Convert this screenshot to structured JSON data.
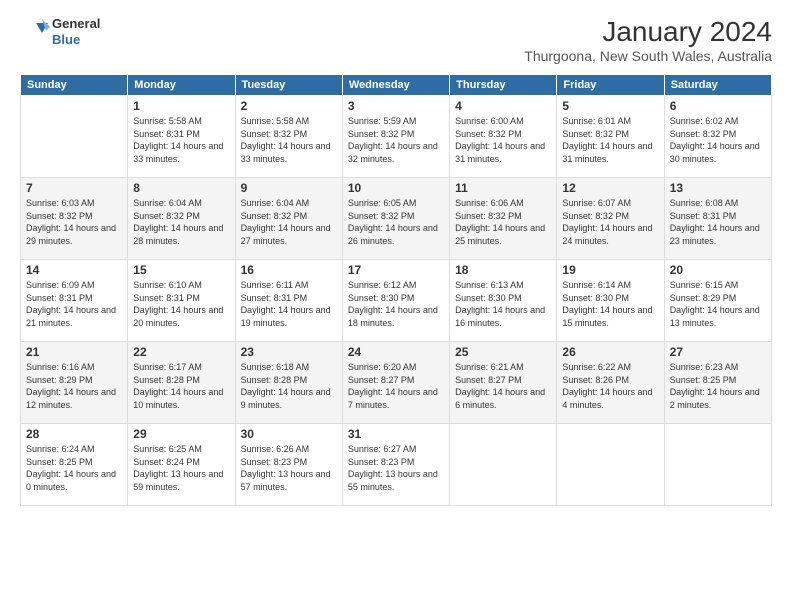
{
  "logo": {
    "line1": "General",
    "line2": "Blue"
  },
  "title": "January 2024",
  "subtitle": "Thurgoona, New South Wales, Australia",
  "weekdays": [
    "Sunday",
    "Monday",
    "Tuesday",
    "Wednesday",
    "Thursday",
    "Friday",
    "Saturday"
  ],
  "weeks": [
    [
      {
        "day": "",
        "sunrise": "",
        "sunset": "",
        "daylight": ""
      },
      {
        "day": "1",
        "sunrise": "Sunrise: 5:58 AM",
        "sunset": "Sunset: 8:31 PM",
        "daylight": "Daylight: 14 hours and 33 minutes."
      },
      {
        "day": "2",
        "sunrise": "Sunrise: 5:58 AM",
        "sunset": "Sunset: 8:32 PM",
        "daylight": "Daylight: 14 hours and 33 minutes."
      },
      {
        "day": "3",
        "sunrise": "Sunrise: 5:59 AM",
        "sunset": "Sunset: 8:32 PM",
        "daylight": "Daylight: 14 hours and 32 minutes."
      },
      {
        "day": "4",
        "sunrise": "Sunrise: 6:00 AM",
        "sunset": "Sunset: 8:32 PM",
        "daylight": "Daylight: 14 hours and 31 minutes."
      },
      {
        "day": "5",
        "sunrise": "Sunrise: 6:01 AM",
        "sunset": "Sunset: 8:32 PM",
        "daylight": "Daylight: 14 hours and 31 minutes."
      },
      {
        "day": "6",
        "sunrise": "Sunrise: 6:02 AM",
        "sunset": "Sunset: 8:32 PM",
        "daylight": "Daylight: 14 hours and 30 minutes."
      }
    ],
    [
      {
        "day": "7",
        "sunrise": "Sunrise: 6:03 AM",
        "sunset": "Sunset: 8:32 PM",
        "daylight": "Daylight: 14 hours and 29 minutes."
      },
      {
        "day": "8",
        "sunrise": "Sunrise: 6:04 AM",
        "sunset": "Sunset: 8:32 PM",
        "daylight": "Daylight: 14 hours and 28 minutes."
      },
      {
        "day": "9",
        "sunrise": "Sunrise: 6:04 AM",
        "sunset": "Sunset: 8:32 PM",
        "daylight": "Daylight: 14 hours and 27 minutes."
      },
      {
        "day": "10",
        "sunrise": "Sunrise: 6:05 AM",
        "sunset": "Sunset: 8:32 PM",
        "daylight": "Daylight: 14 hours and 26 minutes."
      },
      {
        "day": "11",
        "sunrise": "Sunrise: 6:06 AM",
        "sunset": "Sunset: 8:32 PM",
        "daylight": "Daylight: 14 hours and 25 minutes."
      },
      {
        "day": "12",
        "sunrise": "Sunrise: 6:07 AM",
        "sunset": "Sunset: 8:32 PM",
        "daylight": "Daylight: 14 hours and 24 minutes."
      },
      {
        "day": "13",
        "sunrise": "Sunrise: 6:08 AM",
        "sunset": "Sunset: 8:31 PM",
        "daylight": "Daylight: 14 hours and 23 minutes."
      }
    ],
    [
      {
        "day": "14",
        "sunrise": "Sunrise: 6:09 AM",
        "sunset": "Sunset: 8:31 PM",
        "daylight": "Daylight: 14 hours and 21 minutes."
      },
      {
        "day": "15",
        "sunrise": "Sunrise: 6:10 AM",
        "sunset": "Sunset: 8:31 PM",
        "daylight": "Daylight: 14 hours and 20 minutes."
      },
      {
        "day": "16",
        "sunrise": "Sunrise: 6:11 AM",
        "sunset": "Sunset: 8:31 PM",
        "daylight": "Daylight: 14 hours and 19 minutes."
      },
      {
        "day": "17",
        "sunrise": "Sunrise: 6:12 AM",
        "sunset": "Sunset: 8:30 PM",
        "daylight": "Daylight: 14 hours and 18 minutes."
      },
      {
        "day": "18",
        "sunrise": "Sunrise: 6:13 AM",
        "sunset": "Sunset: 8:30 PM",
        "daylight": "Daylight: 14 hours and 16 minutes."
      },
      {
        "day": "19",
        "sunrise": "Sunrise: 6:14 AM",
        "sunset": "Sunset: 8:30 PM",
        "daylight": "Daylight: 14 hours and 15 minutes."
      },
      {
        "day": "20",
        "sunrise": "Sunrise: 6:15 AM",
        "sunset": "Sunset: 8:29 PM",
        "daylight": "Daylight: 14 hours and 13 minutes."
      }
    ],
    [
      {
        "day": "21",
        "sunrise": "Sunrise: 6:16 AM",
        "sunset": "Sunset: 8:29 PM",
        "daylight": "Daylight: 14 hours and 12 minutes."
      },
      {
        "day": "22",
        "sunrise": "Sunrise: 6:17 AM",
        "sunset": "Sunset: 8:28 PM",
        "daylight": "Daylight: 14 hours and 10 minutes."
      },
      {
        "day": "23",
        "sunrise": "Sunrise: 6:18 AM",
        "sunset": "Sunset: 8:28 PM",
        "daylight": "Daylight: 14 hours and 9 minutes."
      },
      {
        "day": "24",
        "sunrise": "Sunrise: 6:20 AM",
        "sunset": "Sunset: 8:27 PM",
        "daylight": "Daylight: 14 hours and 7 minutes."
      },
      {
        "day": "25",
        "sunrise": "Sunrise: 6:21 AM",
        "sunset": "Sunset: 8:27 PM",
        "daylight": "Daylight: 14 hours and 6 minutes."
      },
      {
        "day": "26",
        "sunrise": "Sunrise: 6:22 AM",
        "sunset": "Sunset: 8:26 PM",
        "daylight": "Daylight: 14 hours and 4 minutes."
      },
      {
        "day": "27",
        "sunrise": "Sunrise: 6:23 AM",
        "sunset": "Sunset: 8:25 PM",
        "daylight": "Daylight: 14 hours and 2 minutes."
      }
    ],
    [
      {
        "day": "28",
        "sunrise": "Sunrise: 6:24 AM",
        "sunset": "Sunset: 8:25 PM",
        "daylight": "Daylight: 14 hours and 0 minutes."
      },
      {
        "day": "29",
        "sunrise": "Sunrise: 6:25 AM",
        "sunset": "Sunset: 8:24 PM",
        "daylight": "Daylight: 13 hours and 59 minutes."
      },
      {
        "day": "30",
        "sunrise": "Sunrise: 6:26 AM",
        "sunset": "Sunset: 8:23 PM",
        "daylight": "Daylight: 13 hours and 57 minutes."
      },
      {
        "day": "31",
        "sunrise": "Sunrise: 6:27 AM",
        "sunset": "Sunset: 8:23 PM",
        "daylight": "Daylight: 13 hours and 55 minutes."
      },
      {
        "day": "",
        "sunrise": "",
        "sunset": "",
        "daylight": ""
      },
      {
        "day": "",
        "sunrise": "",
        "sunset": "",
        "daylight": ""
      },
      {
        "day": "",
        "sunrise": "",
        "sunset": "",
        "daylight": ""
      }
    ]
  ]
}
